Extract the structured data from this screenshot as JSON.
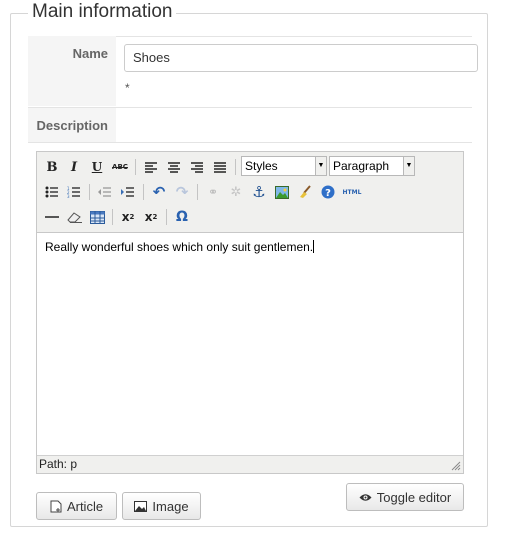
{
  "section": {
    "legend": "Main information"
  },
  "fields": {
    "name_label": "Name",
    "name_value": "Shoes",
    "required_mark": "*",
    "description_label": "Description"
  },
  "editor": {
    "styles_select": "Styles",
    "paragraph_select": "Paragraph",
    "content": "Really wonderful shoes which only suit gentlemen.",
    "path_label": "Path: p",
    "html_label": "HTML"
  },
  "buttons": {
    "article": "Article",
    "image": "Image",
    "toggle_editor": "Toggle editor"
  },
  "icons": [
    "bold-icon",
    "italic-icon",
    "underline-icon",
    "strikethrough-icon",
    "align-left-icon",
    "align-center-icon",
    "align-right-icon",
    "align-justify-icon",
    "bullet-list-icon",
    "numbered-list-icon",
    "outdent-icon",
    "indent-icon",
    "undo-icon",
    "redo-icon",
    "link-icon",
    "unlink-icon",
    "anchor-icon",
    "image-icon",
    "cleanup-icon",
    "help-icon",
    "html-icon",
    "horizontal-rule-icon",
    "eraser-icon",
    "table-icon",
    "subscript-icon",
    "superscript-icon",
    "special-char-icon",
    "article-icon",
    "picture-icon",
    "eye-icon"
  ]
}
